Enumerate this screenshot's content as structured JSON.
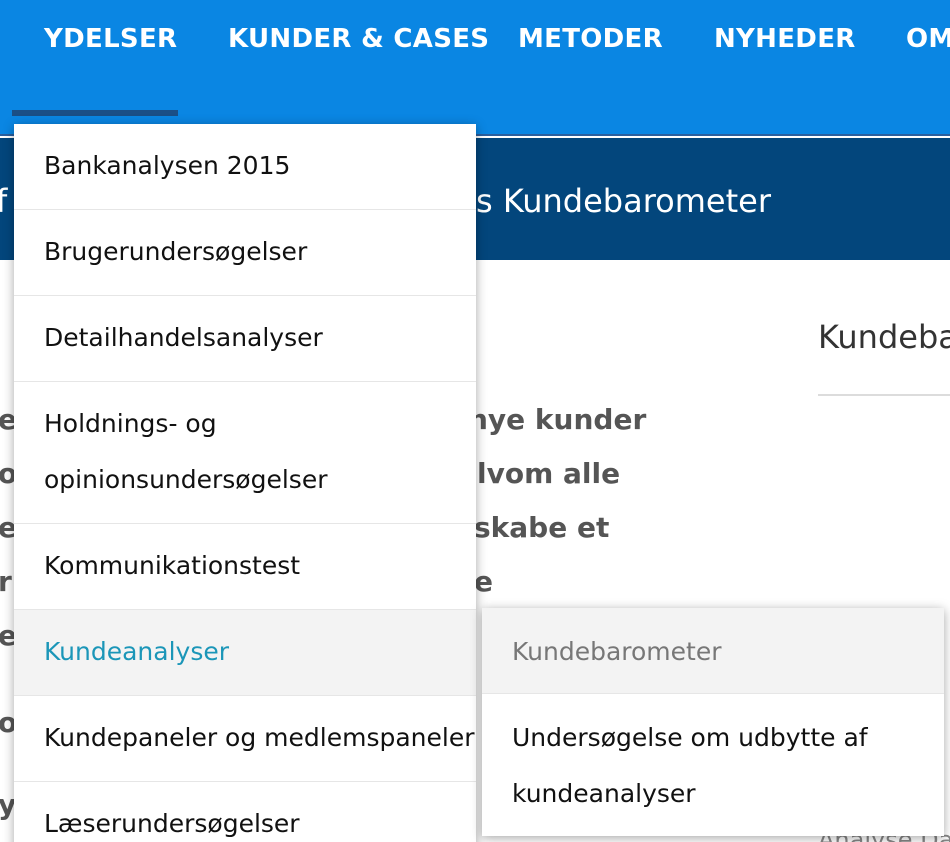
{
  "nav": {
    "items": [
      "YDELSER",
      "KUNDER & CASES",
      "METODER",
      "NYHEDER",
      "OM"
    ]
  },
  "banner": {
    "prefix": "f",
    "title": "s Kundebarometer"
  },
  "body": {
    "lines": [
      "nye kunder",
      "elvom alle",
      "skabe et",
      "e"
    ],
    "left_fragments": [
      "e",
      "o",
      "e",
      "r",
      "e",
      "o",
      "y"
    ]
  },
  "sidebar": {
    "heading": "Kundeba",
    "bottom_text": "Analyse Dan"
  },
  "dropdown": {
    "items": [
      {
        "label": "Bankanalysen 2015"
      },
      {
        "label": "Brugerundersøgelser"
      },
      {
        "label": "Detailhandelsanalyser"
      },
      {
        "label_line1": "Holdnings- og",
        "label_line2": "opinionsundersøgelser"
      },
      {
        "label": "Kommunikationstest"
      },
      {
        "label": "Kundeanalyser"
      },
      {
        "label": "Kundepaneler og medlemspaneler"
      },
      {
        "label": "Læserundersøgelser"
      }
    ]
  },
  "submenu": {
    "items": [
      {
        "label": "Kundebarometer"
      },
      {
        "label_line1": "Undersøgelse om udbytte af",
        "label_line2": "kundeanalyser"
      }
    ]
  },
  "colors": {
    "nav_bg": "#0a86e3",
    "banner_bg": "#03467c",
    "active_link": "#1b96b8"
  }
}
